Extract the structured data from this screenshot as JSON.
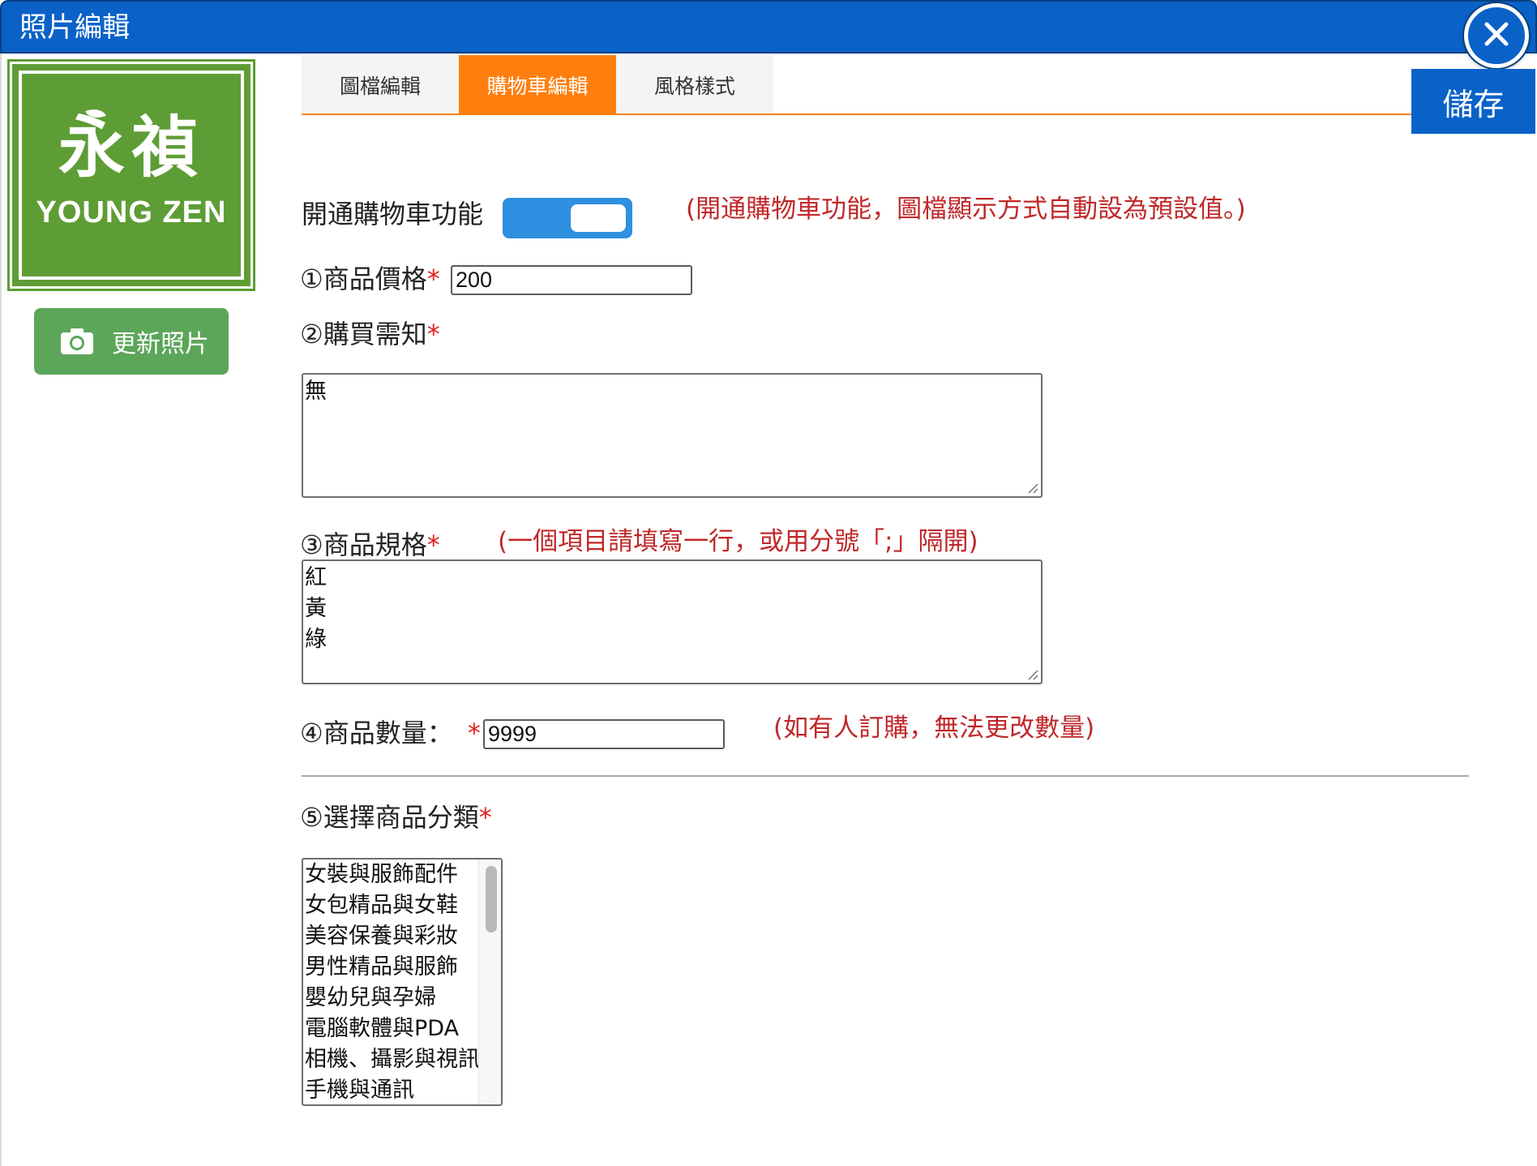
{
  "window": {
    "title": "照片編輯",
    "close_icon": "close-icon"
  },
  "sidebar": {
    "logo_text_cjk": "永禎",
    "logo_text_en": "YOUNG ZEN",
    "logo_color": "#5e9d35",
    "update_photo_label": "更新照片",
    "update_photo_icon": "camera-icon"
  },
  "tabs": [
    {
      "label": "圖檔編輯",
      "active": false
    },
    {
      "label": "購物車編輯",
      "active": true
    },
    {
      "label": "風格樣式",
      "active": false
    }
  ],
  "toolbar": {
    "save_label": "儲存"
  },
  "form": {
    "cart_toggle": {
      "label": "開通購物車功能",
      "enabled": true,
      "note": "(開通購物車功能，圖檔顯示方式自動設為預設值。)"
    },
    "price": {
      "label": "①商品價格",
      "required": "*",
      "value": "200"
    },
    "purchase_notes": {
      "label": "②購買需知",
      "required": "*",
      "lines": [
        "無"
      ]
    },
    "spec": {
      "label": "③商品規格",
      "required": "*",
      "note": "(一個項目請填寫一行，或用分號「;」隔開)",
      "lines": [
        "紅",
        "黃",
        "綠"
      ]
    },
    "quantity": {
      "label": "④商品數量：",
      "required": "*",
      "value": "9999",
      "note": "(如有人訂購，無法更改數量)"
    },
    "category": {
      "label": "⑤選擇商品分類",
      "required": "*",
      "options": [
        "女裝與服飾配件",
        "女包精品與女鞋",
        "美容保養與彩妝",
        "男性精品與服飾",
        "嬰幼兒與孕婦",
        "電腦軟體與PDA",
        "相機、攝影與視訊",
        "手機與通訊"
      ]
    }
  },
  "colors": {
    "titlebar": "#0a62c8",
    "tab_active": "#ff7f0e",
    "toggle_on": "#2f8fe0",
    "note_red": "#c0282a",
    "update_button": "#5ca65a"
  }
}
